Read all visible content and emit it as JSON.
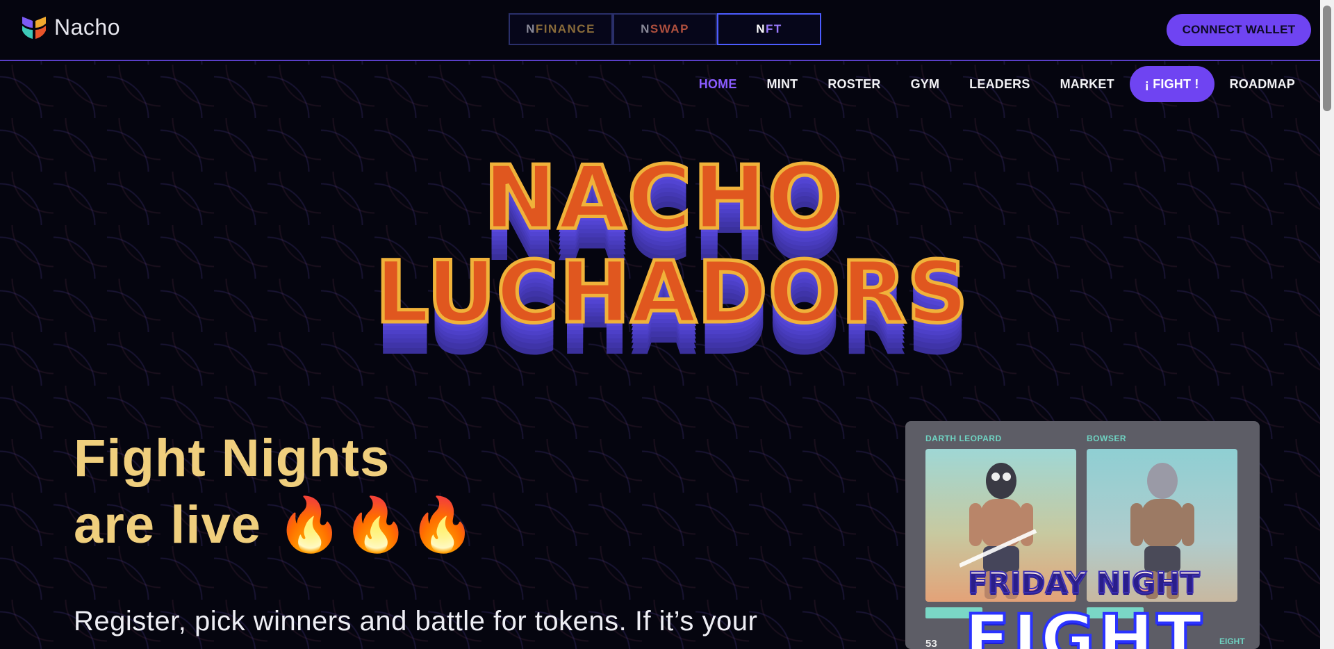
{
  "brand": {
    "name": "Nacho"
  },
  "network_tabs": [
    {
      "n": "N",
      "rest": "FINANCE"
    },
    {
      "n": "N",
      "rest": "SWAP"
    },
    {
      "n": "N",
      "rest": "FT"
    }
  ],
  "header": {
    "connect_label": "CONNECT WALLET"
  },
  "nav": {
    "items": [
      {
        "label": "HOME"
      },
      {
        "label": "MINT"
      },
      {
        "label": "ROSTER"
      },
      {
        "label": "GYM"
      },
      {
        "label": "LEADERS"
      },
      {
        "label": "MARKET"
      },
      {
        "label": "¡ FIGHT !"
      },
      {
        "label": "ROADMAP"
      }
    ]
  },
  "hero": {
    "line1": "NACHO",
    "line2": "LUCHADORS"
  },
  "headline": {
    "line1": "Fight Nights",
    "line2": "are live 🔥🔥🔥"
  },
  "subtext": "Register, pick winners and battle for tokens. If it’s your",
  "card": {
    "fighter_left": "DARTH LEOPARD",
    "fighter_right": "BOWSER",
    "banner_top": "FRIDAY NIGHT",
    "banner_bottom": "FIGHT",
    "stat_number": "53",
    "stat_label": "EIGHT"
  },
  "colors": {
    "accent": "#6f44f2",
    "headline": "#f0cf7d",
    "hero_fill": "#e0571f",
    "hero_outline": "#f0b23a",
    "hero_shadow": "#5848dc"
  }
}
